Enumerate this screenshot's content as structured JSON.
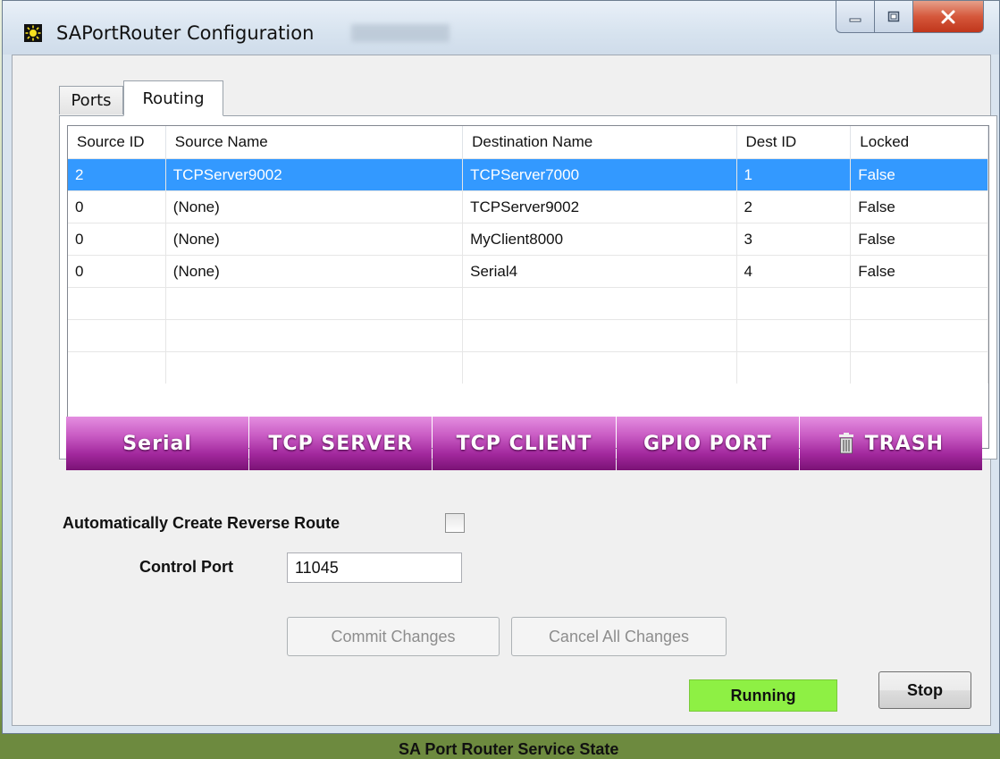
{
  "window": {
    "title": "SAPortRouter Configuration"
  },
  "tabs": [
    {
      "label": "Ports",
      "active": false
    },
    {
      "label": "Routing",
      "active": true
    }
  ],
  "routing_table": {
    "columns": [
      "Source ID",
      "Source Name",
      "Destination Name",
      "Dest ID",
      "Locked"
    ],
    "rows": [
      [
        "2",
        "TCPServer9002",
        "TCPServer7000",
        "1",
        "False"
      ],
      [
        "0",
        "(None)",
        "TCPServer9002",
        "2",
        "False"
      ],
      [
        "0",
        "(None)",
        "MyClient8000",
        "3",
        "False"
      ],
      [
        "0",
        "(None)",
        "Serial4",
        "4",
        "False"
      ]
    ],
    "selected_row": 0
  },
  "port_buttons": {
    "serial": "Serial",
    "tcp_server": "TCP SERVER",
    "tcp_client": "TCP CLIENT",
    "gpio_port": "GPIO PORT",
    "trash": "TRASH"
  },
  "options": {
    "reverse_route_label": "Automatically Create Reverse Route",
    "reverse_route_checked": false,
    "control_port_label": "Control Port",
    "control_port_value": "11045"
  },
  "actions": {
    "commit": "Commit Changes",
    "cancel_all": "Cancel All Changes"
  },
  "service": {
    "state_label": "SA Port Router Service State",
    "state_value": "Running",
    "state_color": "#8ef044",
    "stop_label": "Stop"
  },
  "colors": {
    "selection": "#3399ff",
    "purple_button": "#a2289d"
  }
}
